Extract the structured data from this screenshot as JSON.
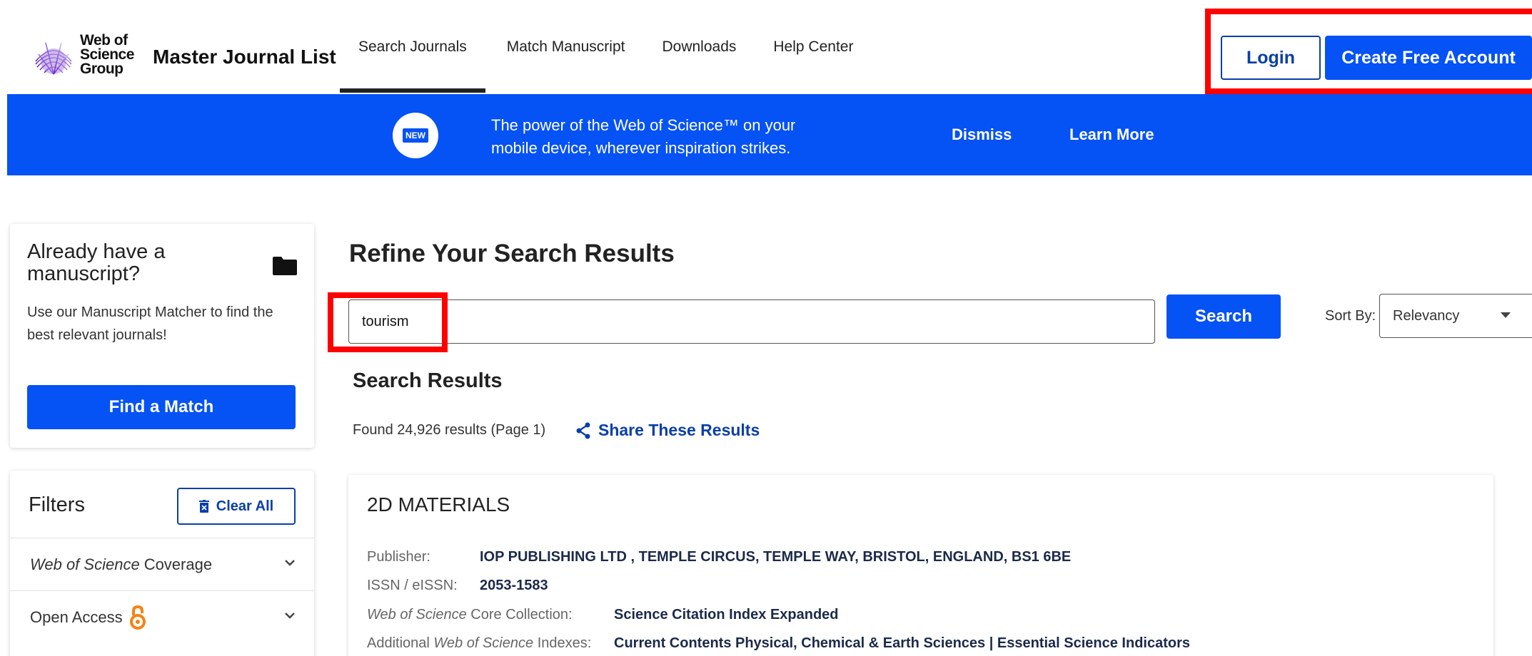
{
  "header": {
    "logo_lines": [
      "Web of",
      "Science",
      "Group"
    ],
    "app_title": "Master Journal List",
    "nav": [
      {
        "label": "Search Journals",
        "active": true
      },
      {
        "label": "Match Manuscript",
        "active": false
      },
      {
        "label": "Downloads",
        "active": false
      },
      {
        "label": "Help Center",
        "active": false
      }
    ],
    "login_label": "Login",
    "create_account_label": "Create Free Account"
  },
  "banner": {
    "badge": "NEW",
    "text": "The power of the Web of Science™ on your mobile device, wherever inspiration strikes.",
    "dismiss": "Dismiss",
    "learn_more": "Learn More"
  },
  "manuscript_card": {
    "title": "Already have a manuscript?",
    "description": "Use our Manuscript Matcher to find the best relevant journals!",
    "button": "Find a Match"
  },
  "filters": {
    "title": "Filters",
    "clear_all": "Clear All",
    "items": [
      {
        "italic": "Web of Science",
        "label": "Coverage"
      },
      {
        "italic": "",
        "label": "Open Access"
      }
    ]
  },
  "main": {
    "refine_title": "Refine Your Search Results",
    "search_value": "tourism",
    "search_button": "Search",
    "sort_label": "Sort By:",
    "sort_value": "Relevancy",
    "results_title": "Search Results",
    "results_count": "Found 24,926 results (Page 1)",
    "share_label": "Share These Results"
  },
  "result": {
    "title": "2D MATERIALS",
    "publisher_label": "Publisher:",
    "publisher_value": "IOP PUBLISHING LTD , TEMPLE CIRCUS, TEMPLE WAY, BRISTOL, ENGLAND, BS1 6BE",
    "issn_label": "ISSN / eISSN:",
    "issn_value": "2053-1583",
    "core_label_italic": "Web of Science",
    "core_label_rest": "Core Collection:",
    "core_value": "Science Citation Index Expanded",
    "additional_label_pre": "Additional",
    "additional_label_italic": "Web of Science",
    "additional_label_post": "Indexes:",
    "additional_value": "Current Contents Physical, Chemical & Earth Sciences | Essential Science Indicators"
  },
  "colors": {
    "primary_blue": "#0552f5",
    "dark_blue_text": "#0b3fa8",
    "highlight_red": "#ff0000",
    "open_access_orange": "#f68212"
  }
}
